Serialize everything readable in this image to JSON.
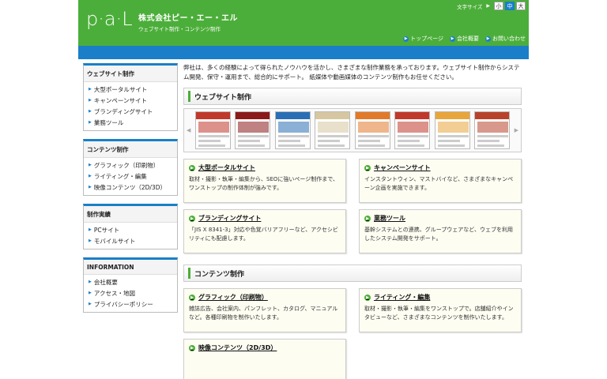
{
  "header": {
    "company_name": "株式会社ピー・エー・エル",
    "tagline": "ウェブサイト制作・コンテンツ制作",
    "font_size_label": "文字サイズ",
    "font_sizes": [
      "小",
      "中",
      "大"
    ],
    "nav": [
      "トップページ",
      "会社概要",
      "お問い合わせ"
    ]
  },
  "sidebar": [
    {
      "title": "ウェブサイト制作",
      "items": [
        "大型ポータルサイト",
        "キャンペーンサイト",
        "ブランディングサイト",
        "業務ツール"
      ]
    },
    {
      "title": "コンテンツ制作",
      "items": [
        "グラフィック（印刷物）",
        "ライティング・編集",
        "映像コンテンツ（2D/3D）"
      ]
    },
    {
      "title": "制作実績",
      "items": [
        "PCサイト",
        "モバイルサイト"
      ]
    },
    {
      "title": "INFORMATION",
      "items": [
        "会社概要",
        "アクセス・地図",
        "プライバシーポリシー"
      ]
    }
  ],
  "intro": "弊社は、多くの経験によって得られたノウハウを活かし、さまざまな制作業務を承っております。ウェブサイト制作からシステム開発、保守・運用まで、総合的にサポート。 紙媒体や動画媒体のコンテンツ制作もお任せください。",
  "sections": [
    {
      "title": "ウェブサイト制作",
      "cards": [
        {
          "title": "大型ポータルサイト",
          "desc": "取材・撮影・執筆・編集から、SEOに強いページ制作まで、ワンストップの制作体制が強みです。"
        },
        {
          "title": "キャンペーンサイト",
          "desc": "インスタントウィン、マストバイなど、さまざまなキャンペーン企画を実施できます。"
        },
        {
          "title": "ブランディングサイト",
          "desc": "「JIS X 8341-3」対応や色覚バリアフリーなど、アクセシビリティにも配慮します。"
        },
        {
          "title": "業務ツール",
          "desc": "基幹システムとの連携、グループウェアなど、ウェブを利用したシステム開発をサポート。"
        }
      ]
    },
    {
      "title": "コンテンツ制作",
      "cards": [
        {
          "title": "グラフィック（印刷物）",
          "desc": "雑誌広告、会社案内、パンフレット、カタログ、マニュアルなど。各種印刷物を制作いたします。"
        },
        {
          "title": "ライティング・編集",
          "desc": "取材・撮影・執筆・編集をワンストップで。店舗紹介やインタビューなど、さまざまなコンテンツを制作いたします。"
        },
        {
          "title": "映像コンテンツ（2D/3D）",
          "desc": ""
        }
      ]
    }
  ],
  "gallery_colors": [
    "#c0392b",
    "#8b1a1a",
    "#2a6fb5",
    "#d6c7a0",
    "#e07a2a",
    "#c0392b",
    "#e8a53c",
    "#b8432c"
  ]
}
